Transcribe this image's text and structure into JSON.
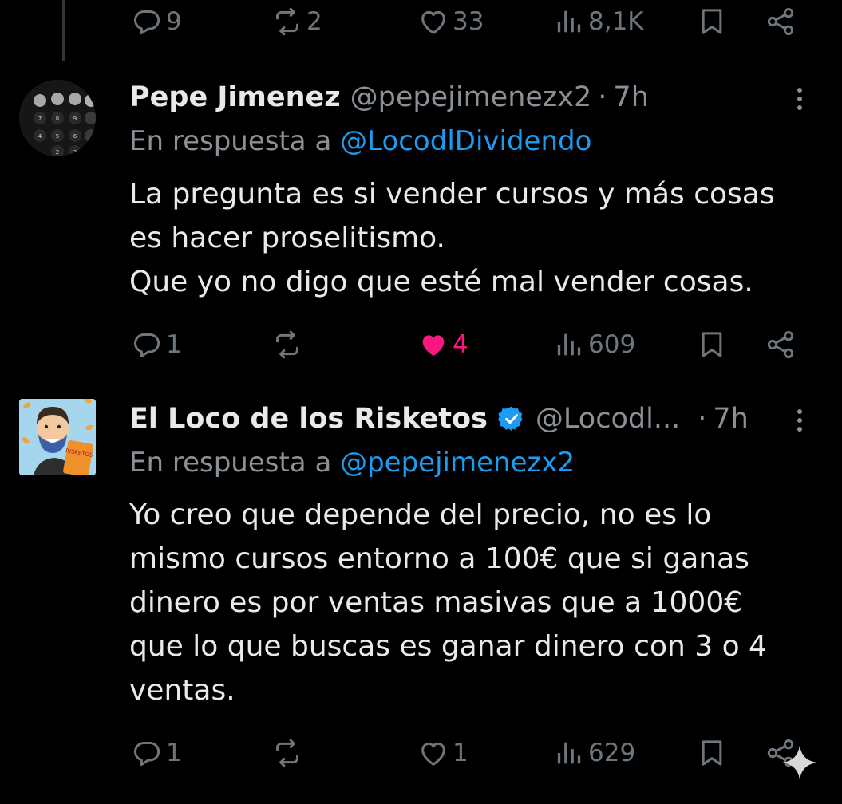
{
  "top_tweet_actions": {
    "replies": "9",
    "retweets": "2",
    "likes": "33",
    "views": "8,1K"
  },
  "tweets": [
    {
      "name": "Pepe Jimenez",
      "handle": "@pepejimenezx2",
      "separator": "·",
      "time": "7h",
      "verified": false,
      "reply_prefix": "En respuesta a",
      "reply_to": "@LocodlDividendo",
      "text_lines": [
        "La pregunta es si vender cursos y más cosas",
        "es hacer proselitismo.",
        "Que yo no digo que esté mal vender cosas."
      ],
      "actions": {
        "replies": "1",
        "retweets": "",
        "likes": "4",
        "views": "609",
        "liked": true
      }
    },
    {
      "name": "El Loco de los Risketos",
      "handle": "@Locodl...",
      "separator": "·",
      "time": "7h",
      "verified": true,
      "reply_prefix": "En respuesta a",
      "reply_to": "@pepejimenezx2",
      "text_lines": [
        "Yo creo que depende del precio, no es lo",
        "mismo cursos entorno a 100€ que si ganas",
        "dinero es por ventas masivas que a 1000€",
        "que lo que buscas es ganar dinero con 3 o 4",
        "ventas."
      ],
      "actions": {
        "replies": "1",
        "retweets": "",
        "likes": "1",
        "views": "629",
        "liked": false
      }
    }
  ],
  "avatar_keys": [
    "7",
    "8",
    "9",
    "4",
    "5",
    "6",
    "2",
    "3"
  ],
  "avatar_badge_text": "RISKETOS",
  "icons": [
    "reply-icon",
    "retweet-icon",
    "like-icon",
    "views-icon",
    "bookmark-icon",
    "share-icon",
    "more-icon",
    "verified-badge-icon",
    "sparkle-icon"
  ],
  "colors": {
    "background": "#000000",
    "text": "#e7e9ea",
    "secondary": "#8b9096",
    "link": "#1d9bf0",
    "like": "#f91880",
    "verified": "#1d9bf0"
  }
}
